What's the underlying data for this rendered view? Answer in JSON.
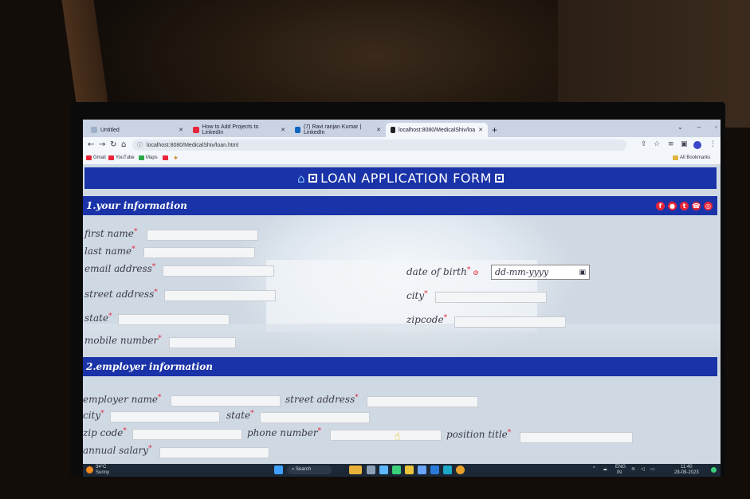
{
  "browser": {
    "tabs": [
      {
        "label": "Untitled",
        "color": "#c9d3e3"
      },
      {
        "label": "How to Add Projects to LinkedIn",
        "color": "#e8263a"
      },
      {
        "label": "(7) Ravi ranjan Kumar | LinkedIn",
        "color": "#0a66c2"
      },
      {
        "label": "localhost:8080/MedicalShiv/loa",
        "color": "#222222"
      }
    ],
    "new_tab": "+",
    "url": "localhost:8080/MedicalShiv/loan.html",
    "bookmarks": [
      "Gmail",
      "YouTube",
      "Maps"
    ],
    "all_bookmarks": "All Bookmarks"
  },
  "page": {
    "title": "LOAN APPLICATION FORM",
    "section1": "1.your information",
    "section2": "2.employer information",
    "required_mark": "*",
    "fields": {
      "first_name": "first name",
      "last_name": "last name",
      "email": "email address",
      "street": "street address",
      "state": "state",
      "mobile": "mobile number",
      "dob": "date of birth",
      "city": "city",
      "zipcode": "zipcode",
      "employer_name": "employer name",
      "emp_street": "street address",
      "emp_city": "city",
      "emp_state": "state",
      "emp_zip": "zip code",
      "phone": "phone number",
      "position": "position title",
      "salary": "annual salary"
    },
    "dob_placeholder": "dd-mm-yyyy",
    "accent_color": "#1a33a8",
    "required_color": "#e8263a"
  },
  "taskbar": {
    "weather_temp": "34°C",
    "weather_desc": "Sunny",
    "search": "Search",
    "lang": "ENG",
    "region": "IN",
    "time": "11:40",
    "date": "28-09-2023"
  }
}
